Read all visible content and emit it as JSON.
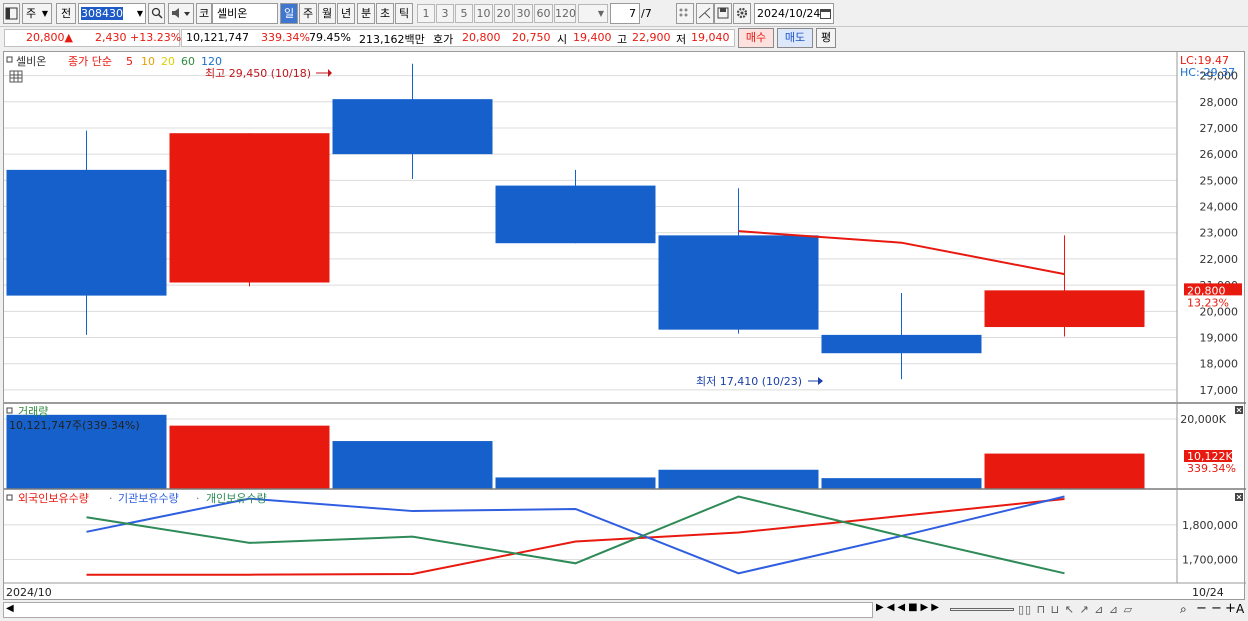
{
  "toolbar": {
    "period_type": "주",
    "prev_label": "전",
    "code": "308430",
    "market_label": "코",
    "stock_name": "셀비온",
    "day_btn": "일",
    "week_btn": "주",
    "month_btn": "월",
    "year_btn": "년",
    "min_btn": "분",
    "sec_btn": "초",
    "tick_btn": "틱",
    "periods": [
      "1",
      "3",
      "5",
      "10",
      "20",
      "30",
      "60",
      "120"
    ],
    "count": "7",
    "total": "/7",
    "date": "2024/10/24"
  },
  "quote": {
    "price": "20,800▲",
    "change": "2,430",
    "change_pct": "+13.23%",
    "volume": "10,121,747",
    "vol_ratio": "339.34%",
    "turnover_ratio": "79.45%",
    "amount": "213,162백만",
    "hoga_label": "호가",
    "ask": "20,800",
    "bid": "20,750",
    "open_label": "시",
    "open": "19,400",
    "high_label": "고",
    "high": "22,900",
    "low_label": "저",
    "low": "19,040",
    "buy_label": "매수",
    "sell_label": "매도",
    "eval_label": "평"
  },
  "legend": {
    "name": "셀비온",
    "ma_label": "종가 단순",
    "ma_periods": [
      "5",
      "10",
      "20",
      "60",
      "120"
    ]
  },
  "annotations": {
    "high_text": "최고 29,450 (10/18)",
    "low_text": "최저 17,410 (10/23)",
    "lc": "LC:19.47",
    "hc": "HC:-29.37",
    "price_tag": "20,800",
    "pct_tag": "13.23%",
    "vol_title": "거래량",
    "vol_info": "10,121,747주(339.34%)",
    "vol_tag": "10,122K",
    "vol_pct_tag": "339.34%",
    "date_left": "2024/10",
    "date_right": "10/24"
  },
  "colors": {
    "up": "#e8190f",
    "down": "#1660cc",
    "ma5": "#e8190f",
    "ma10": "#e8a000",
    "ma20": "#e0d000",
    "ma60": "#2e8b3e",
    "ma120": "#1b6fd0",
    "foreign": "#e8190f",
    "institution": "#2f5ee0",
    "individual": "#2e8b57"
  },
  "chart_data": [
    {
      "type": "candlestick",
      "title": "셀비온",
      "ylim": [
        16500,
        29900
      ],
      "yticks": [
        17000,
        18000,
        19000,
        20000,
        21000,
        22000,
        23000,
        24000,
        25000,
        26000,
        27000,
        28000,
        29000
      ],
      "candles": [
        {
          "open": 25400,
          "high": 26900,
          "low": 19100,
          "close": 20600
        },
        {
          "open": 21100,
          "high": 26800,
          "low": 20950,
          "close": 26800
        },
        {
          "open": 28100,
          "high": 29450,
          "low": 25050,
          "close": 26000
        },
        {
          "open": 24800,
          "high": 25400,
          "low": 22600,
          "close": 22600
        },
        {
          "open": 22900,
          "high": 24700,
          "low": 19150,
          "close": 19300
        },
        {
          "open": 19100,
          "high": 20700,
          "low": 17410,
          "close": 18400
        },
        {
          "open": 19400,
          "high": 22900,
          "low": 19040,
          "close": 20800
        }
      ],
      "ma5": [
        null,
        null,
        null,
        null,
        23060,
        22620,
        21420
      ]
    },
    {
      "type": "bar",
      "title": "거래량",
      "ytick_labels": [
        "20,000K"
      ],
      "values": [
        21200,
        18100,
        13700,
        3300,
        5500,
        3100,
        10122
      ]
    },
    {
      "type": "line",
      "ytick_labels": [
        "1,800,000",
        "1,700,000"
      ],
      "series": [
        {
          "name": "외국인보유수량",
          "values": [
            1656000,
            1656000,
            1658000,
            1752000,
            1778000,
            1826000,
            1875000
          ]
        },
        {
          "name": "기관보유수량",
          "values": [
            1780000,
            1876000,
            1840000,
            1846000,
            1660000,
            1768000,
            1882000
          ]
        },
        {
          "name": "개인보유수량",
          "values": [
            1822000,
            1748000,
            1766000,
            1689000,
            1882000,
            1768000,
            1660000
          ]
        }
      ]
    }
  ]
}
